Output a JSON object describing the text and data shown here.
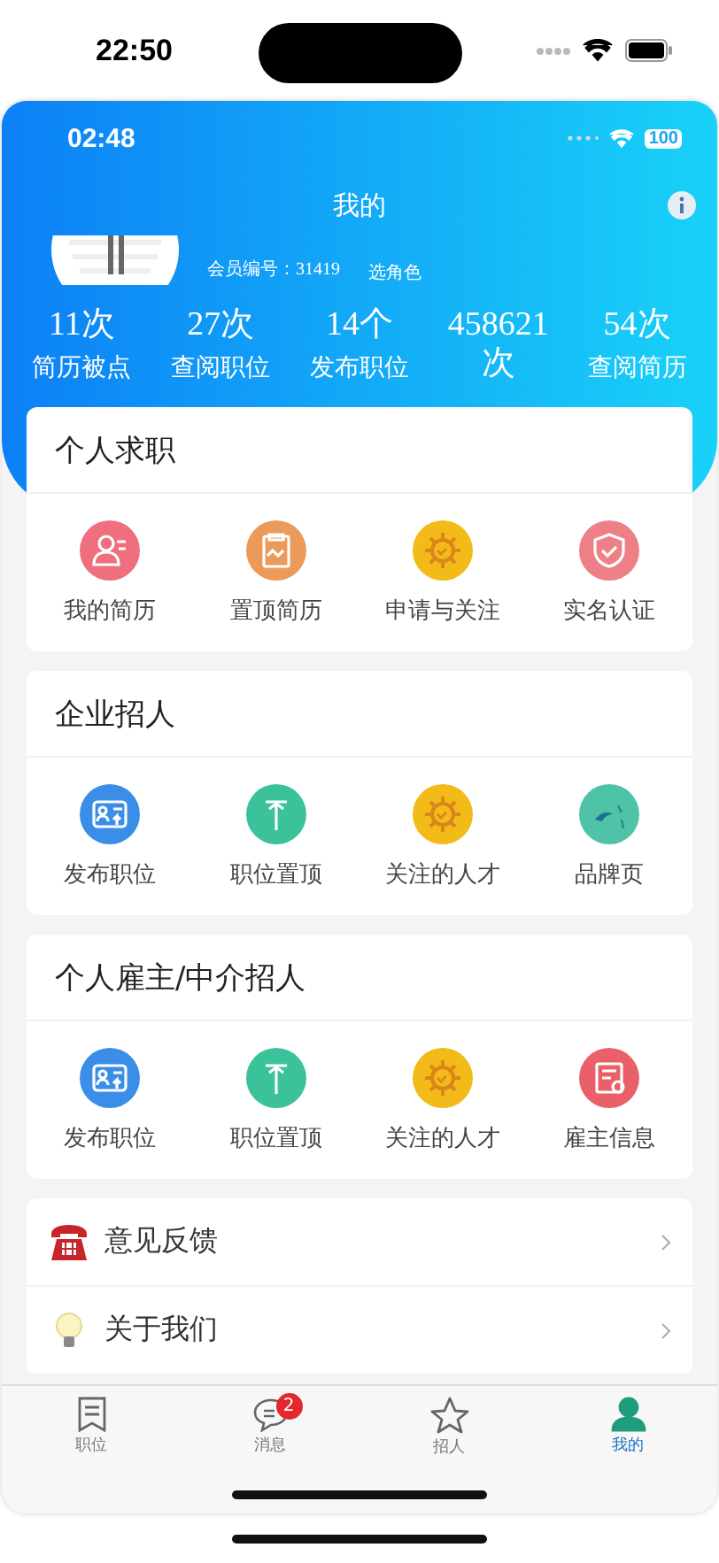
{
  "outer_status_bar": {
    "time": "22:50"
  },
  "inner_status_bar": {
    "time": "02:48",
    "battery": "100"
  },
  "header": {
    "title": "我的",
    "member_label": "会员编号：",
    "member_id": "31419",
    "role_link": "选角色"
  },
  "stats": [
    {
      "value": "11次",
      "label": "简历被点"
    },
    {
      "value": "27次",
      "label": "查阅职位"
    },
    {
      "value": "14个",
      "label": "发布职位"
    },
    {
      "value": "458621 次"
    },
    {
      "value": "54次",
      "label": "查阅简历"
    }
  ],
  "sections": [
    {
      "title": "个人求职",
      "items": [
        {
          "label": "我的简历",
          "kind": "person",
          "color": "#ef6f7f"
        },
        {
          "label": "置顶简历",
          "kind": "clipboard",
          "color": "#eb9a5a"
        },
        {
          "label": "申请与关注",
          "kind": "gear",
          "color": "#f2bb1a"
        },
        {
          "label": "实名认证",
          "kind": "shield",
          "color": "#ee7f86"
        }
      ]
    },
    {
      "title": "企业招人",
      "items": [
        {
          "label": "发布职位",
          "kind": "card",
          "color": "#3b8ee8"
        },
        {
          "label": "职位置顶",
          "kind": "pin",
          "color": "#3cc29a"
        },
        {
          "label": "关注的人才",
          "kind": "gear",
          "color": "#f2bb1a"
        },
        {
          "label": "品牌页",
          "kind": "bird",
          "color": "#4ec3a8"
        }
      ]
    },
    {
      "title": "个人雇主/中介招人",
      "items": [
        {
          "label": "发布职位",
          "kind": "card",
          "color": "#3b8ee8"
        },
        {
          "label": "职位置顶",
          "kind": "pin",
          "color": "#3cc29a"
        },
        {
          "label": "关注的人才",
          "kind": "gear",
          "color": "#f2bb1a"
        },
        {
          "label": "雇主信息",
          "kind": "certificate",
          "color": "#ea6068"
        }
      ]
    }
  ],
  "menu": [
    {
      "label": "意见反馈",
      "kind": "phone"
    },
    {
      "label": "关于我们",
      "kind": "bulb"
    }
  ],
  "tabs": [
    {
      "label": "职位",
      "kind": "list",
      "selected": false
    },
    {
      "label": "消息",
      "kind": "chat",
      "selected": false,
      "badge": "2"
    },
    {
      "label": "招人",
      "kind": "star",
      "selected": false
    },
    {
      "label": "我的",
      "kind": "person",
      "selected": true
    }
  ]
}
